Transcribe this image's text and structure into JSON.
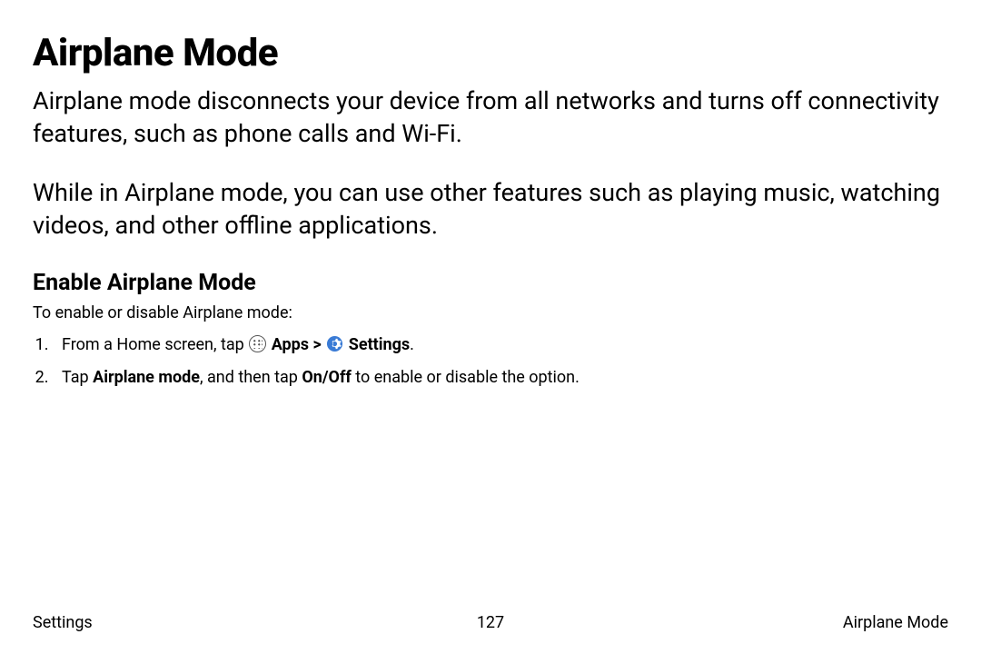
{
  "title": "Airplane Mode",
  "para1": "Airplane mode disconnects your device from all networks and turns off connectivity features, such as phone calls and Wi-Fi.",
  "para2": "While in Airplane mode, you can use other features such as playing music, watching videos, and other offline applications.",
  "section": {
    "heading": "Enable Airplane Mode",
    "intro": "To enable or disable Airplane mode:",
    "step1": {
      "pre": "From a Home screen, tap ",
      "apps": "Apps",
      "sep": " > ",
      "settings": "Settings",
      "post": "."
    },
    "step2": {
      "pre": "Tap ",
      "b1": "Airplane mode",
      "mid": ", and then tap ",
      "b2": "On/Off",
      "post": " to enable or disable the option."
    }
  },
  "footer": {
    "left": "Settings",
    "center": "127",
    "right": "Airplane Mode"
  }
}
